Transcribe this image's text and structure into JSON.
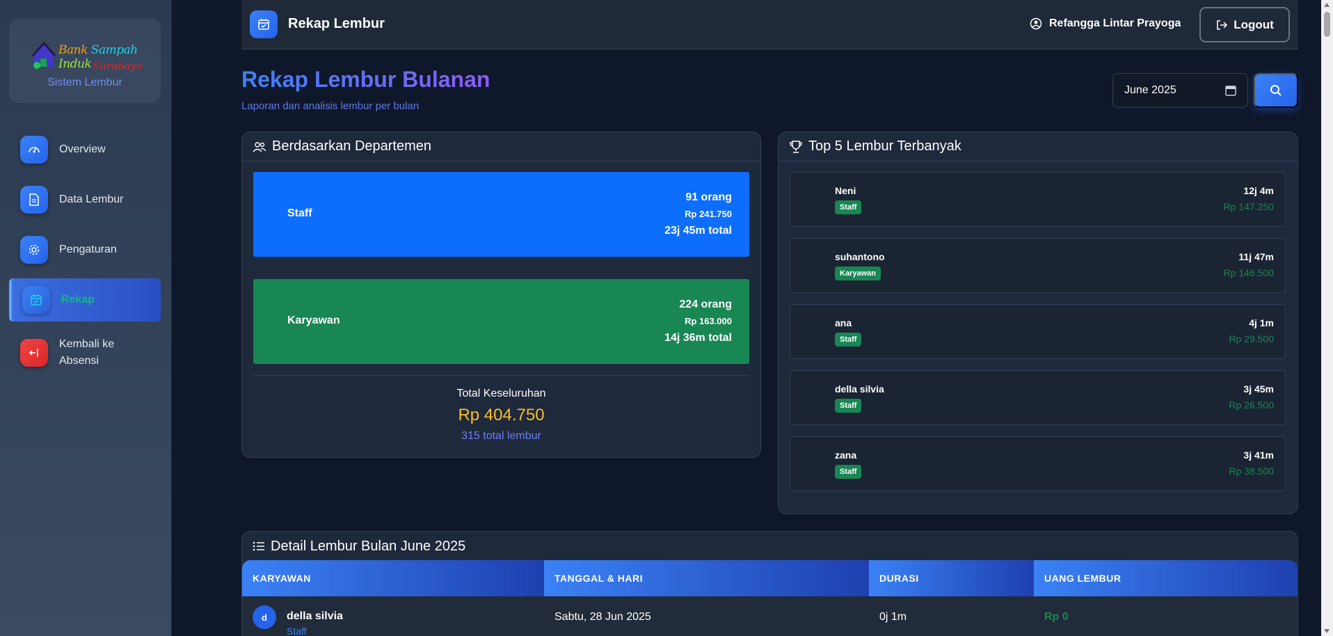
{
  "brand": {
    "logo_word1": "Bank",
    "logo_word2": "Sampah",
    "logo_word3": "Induk",
    "logo_line2": "Surabaya",
    "subtitle": "Sistem Lembur"
  },
  "sidebar": {
    "items": [
      {
        "label": "Overview",
        "icon": "speedometer-icon"
      },
      {
        "label": "Data Lembur",
        "icon": "document-icon"
      },
      {
        "label": "Pengaturan",
        "icon": "gear-icon"
      },
      {
        "label": "Rekap",
        "icon": "calendar-check-icon",
        "active": true
      },
      {
        "label": "Kembali ke Absensi",
        "icon": "back-arrow-icon"
      }
    ]
  },
  "topbar": {
    "title": "Rekap Lembur",
    "user_name": "Refangga Lintar Prayoga",
    "logout_label": "Logout"
  },
  "page": {
    "title": "Rekap Lembur Bulanan",
    "subtitle": "Laporan dan analisis lembur per bulan",
    "month_value": "June 2025"
  },
  "departments": {
    "header": "Berdasarkan Departemen",
    "items": [
      {
        "name": "Staff",
        "count": "91 orang",
        "money": "Rp 241.750",
        "total": "23j 45m total",
        "color": "#0d6efd"
      },
      {
        "name": "Karyawan",
        "count": "224 orang",
        "money": "Rp 163.000",
        "total": "14j 36m total",
        "color": "#198754"
      }
    ],
    "total_label": "Total Keseluruhan",
    "total_amount": "Rp 404.750",
    "total_count": "315 total lembur"
  },
  "top5": {
    "header": "Top 5 Lembur Terbanyak",
    "items": [
      {
        "name": "Neni",
        "dept": "Staff",
        "duration": "12j 4m",
        "money": "Rp 147.250"
      },
      {
        "name": "suhantono",
        "dept": "Karyawan",
        "duration": "11j 47m",
        "money": "Rp 146.500"
      },
      {
        "name": "ana",
        "dept": "Staff",
        "duration": "4j 1m",
        "money": "Rp 29.500"
      },
      {
        "name": "della silvia",
        "dept": "Staff",
        "duration": "3j 45m",
        "money": "Rp 26.500"
      },
      {
        "name": "zana",
        "dept": "Staff",
        "duration": "3j 41m",
        "money": "Rp 38.500"
      }
    ]
  },
  "detail": {
    "header": "Detail Lembur Bulan June 2025",
    "columns": [
      "KARYAWAN",
      "TANGGAL & HARI",
      "DURASI",
      "UANG LEMBUR"
    ],
    "rows": [
      {
        "initial": "d",
        "name": "della silvia",
        "dept": "Staff",
        "date": "Sabtu, 28 Jun 2025",
        "duration": "0j 1m",
        "money": "Rp 0"
      }
    ]
  }
}
